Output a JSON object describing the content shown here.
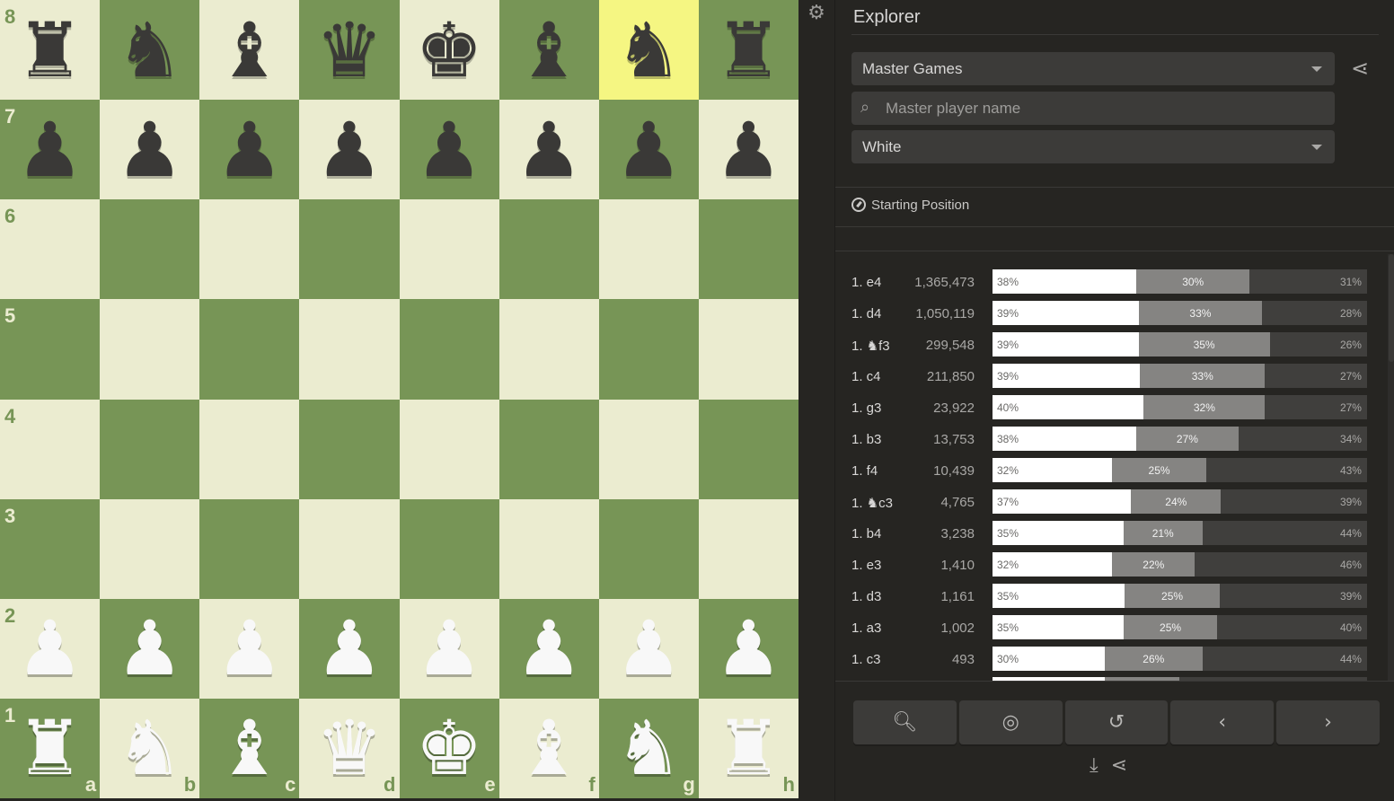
{
  "board": {
    "highlight_square": "g8",
    "ranks": [
      "8",
      "7",
      "6",
      "5",
      "4",
      "3",
      "2",
      "1"
    ],
    "files": [
      "a",
      "b",
      "c",
      "d",
      "e",
      "f",
      "g",
      "h"
    ],
    "position": [
      [
        "br",
        "bn",
        "bb",
        "bq",
        "bk",
        "bb",
        "bn",
        "br"
      ],
      [
        "bp",
        "bp",
        "bp",
        "bp",
        "bp",
        "bp",
        "bp",
        "bp"
      ],
      [
        "",
        "",
        "",
        "",
        "",
        "",
        "",
        ""
      ],
      [
        "",
        "",
        "",
        "",
        "",
        "",
        "",
        ""
      ],
      [
        "",
        "",
        "",
        "",
        "",
        "",
        "",
        ""
      ],
      [
        "",
        "",
        "",
        "",
        "",
        "",
        "",
        ""
      ],
      [
        "wp",
        "wp",
        "wp",
        "wp",
        "wp",
        "wp",
        "wp",
        "wp"
      ],
      [
        "wr",
        "wn",
        "wb",
        "wq",
        "wk",
        "wb",
        "wn",
        "wr"
      ]
    ],
    "colors": {
      "light": "#ebecd0",
      "dark": "#779556",
      "highlight": "#f5f682"
    }
  },
  "settings_icon": "gear-icon",
  "explorer": {
    "title": "Explorer",
    "database_select": "Master Games",
    "player_search": {
      "placeholder": "Master player name",
      "value": ""
    },
    "color_select": "White",
    "position_label": "Starting Position",
    "moves": [
      {
        "move": "1. e4",
        "games": "1,365,473",
        "white": 38,
        "draw": 30,
        "black": 31,
        "white_label": "38%",
        "draw_label": "30%",
        "black_label": "31%"
      },
      {
        "move": "1. d4",
        "games": "1,050,119",
        "white": 39,
        "draw": 33,
        "black": 28,
        "white_label": "39%",
        "draw_label": "33%",
        "black_label": "28%"
      },
      {
        "move": "1. ♞f3",
        "games": "299,548",
        "white": 39,
        "draw": 35,
        "black": 26,
        "white_label": "39%",
        "draw_label": "35%",
        "black_label": "26%"
      },
      {
        "move": "1. c4",
        "games": "211,850",
        "white": 39,
        "draw": 33,
        "black": 27,
        "white_label": "39%",
        "draw_label": "33%",
        "black_label": "27%"
      },
      {
        "move": "1. g3",
        "games": "23,922",
        "white": 40,
        "draw": 32,
        "black": 27,
        "white_label": "40%",
        "draw_label": "32%",
        "black_label": "27%"
      },
      {
        "move": "1. b3",
        "games": "13,753",
        "white": 38,
        "draw": 27,
        "black": 34,
        "white_label": "38%",
        "draw_label": "27%",
        "black_label": "34%"
      },
      {
        "move": "1. f4",
        "games": "10,439",
        "white": 32,
        "draw": 25,
        "black": 43,
        "white_label": "32%",
        "draw_label": "25%",
        "black_label": "43%"
      },
      {
        "move": "1. ♞c3",
        "games": "4,765",
        "white": 37,
        "draw": 24,
        "black": 39,
        "white_label": "37%",
        "draw_label": "24%",
        "black_label": "39%"
      },
      {
        "move": "1. b4",
        "games": "3,238",
        "white": 35,
        "draw": 21,
        "black": 44,
        "white_label": "35%",
        "draw_label": "21%",
        "black_label": "44%"
      },
      {
        "move": "1. e3",
        "games": "1,410",
        "white": 32,
        "draw": 22,
        "black": 46,
        "white_label": "32%",
        "draw_label": "22%",
        "black_label": "46%"
      },
      {
        "move": "1. d3",
        "games": "1,161",
        "white": 35,
        "draw": 25,
        "black": 39,
        "white_label": "35%",
        "draw_label": "25%",
        "black_label": "39%"
      },
      {
        "move": "1. a3",
        "games": "1,002",
        "white": 35,
        "draw": 25,
        "black": 40,
        "white_label": "35%",
        "draw_label": "25%",
        "black_label": "40%"
      },
      {
        "move": "1. c3",
        "games": "493",
        "white": 30,
        "draw": 26,
        "black": 44,
        "white_label": "30%",
        "draw_label": "26%",
        "black_label": "44%"
      }
    ],
    "controls": [
      {
        "name": "analysis-button",
        "icon": "magnifier-icon"
      },
      {
        "name": "explore-button",
        "icon": "target-icon"
      },
      {
        "name": "reset-button",
        "icon": "rotate-icon"
      },
      {
        "name": "previous-move-button",
        "icon": "chevron-left-icon"
      },
      {
        "name": "next-move-button",
        "icon": "chevron-right-icon"
      }
    ],
    "bottom_icons": [
      "download-icon",
      "share-icon"
    ]
  }
}
